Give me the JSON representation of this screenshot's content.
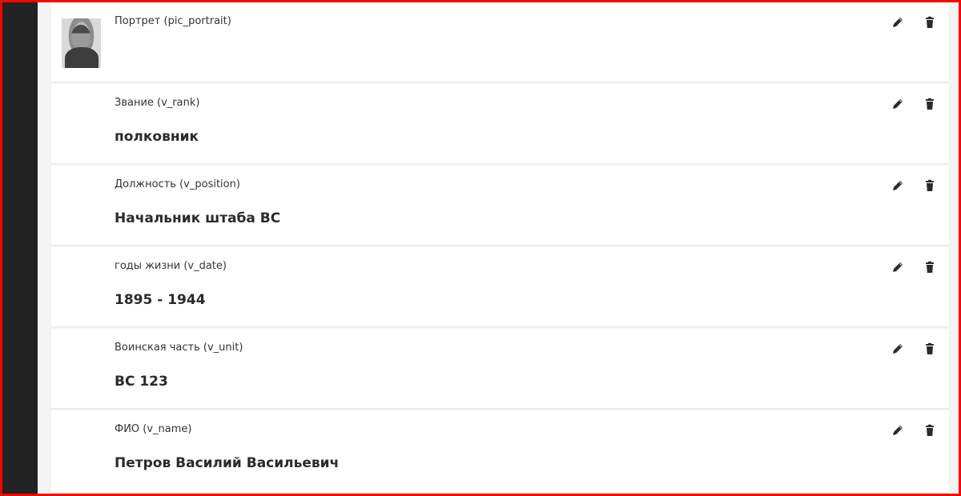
{
  "fields": [
    {
      "label": "Портрет (pic_portrait)",
      "value": ""
    },
    {
      "label": "Звание (v_rank)",
      "value": "полковник"
    },
    {
      "label": "Должность (v_position)",
      "value": "Начальник штаба ВС"
    },
    {
      "label": "годы жизни (v_date)",
      "value": "1895 - 1944"
    },
    {
      "label": "Воинская часть (v_unit)",
      "value": "ВС 123"
    },
    {
      "label": "ФИО (v_name)",
      "value": "Петров Василий Васильевич"
    }
  ],
  "icons": {
    "edit": "pencil-icon",
    "delete": "trash-icon"
  },
  "colors": {
    "frame_border": "#ff0000",
    "sidebar": "#222222"
  }
}
